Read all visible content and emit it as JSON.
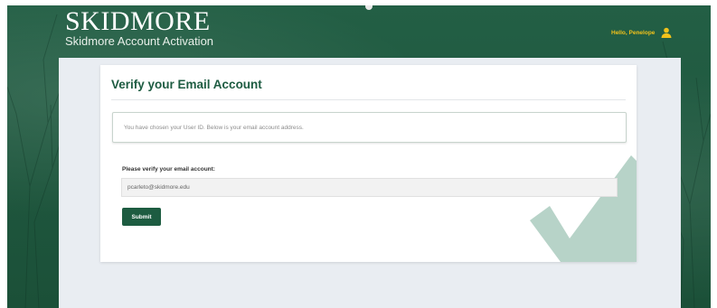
{
  "header": {
    "brand_name": "SKIDMORE",
    "brand_subtitle": "Skidmore Account Activation",
    "greeting": "Hello, Penelope",
    "user_icon": "user-icon"
  },
  "card": {
    "title": "Verify your Email Account",
    "info_message": "You have chosen your User ID. Below is your email account address.",
    "field_label": "Please verify your email account:",
    "email_value": "pcarleto@skidmore.edu",
    "submit_label": "Submit",
    "decor_icon": "checkmark-icon"
  },
  "colors": {
    "brand_green": "#1e5c42",
    "greeting_yellow": "#f1c21b",
    "checkmark": "#b7d3c8"
  }
}
